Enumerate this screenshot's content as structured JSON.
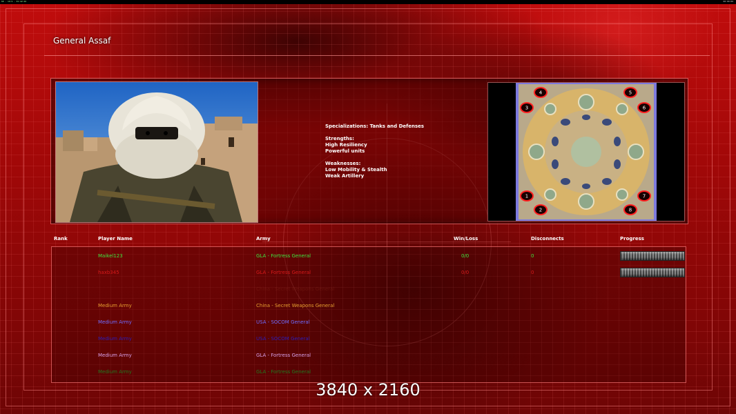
{
  "topbar": {
    "left": "60 · 16:9 · 01:42:46",
    "right": "00:00:00"
  },
  "general": {
    "name": "General Assaf"
  },
  "info": {
    "specializations": "Specializations: Tanks and Defenses",
    "strengths_label": "Strengths:",
    "strengths": [
      "High Resiliency",
      "Powerful units"
    ],
    "weaknesses_label": "Weaknesses:",
    "weaknesses": [
      "Low Mobility & Stealth",
      "Weak Artillery"
    ]
  },
  "map": {
    "start_positions": [
      "1",
      "2",
      "3",
      "4",
      "5",
      "6",
      "7",
      "8"
    ]
  },
  "table": {
    "headers": {
      "rank": "Rank",
      "player": "Player Name",
      "army": "Army",
      "winloss": "Win/Loss",
      "disconnects": "Disconnects",
      "progress": "Progress"
    },
    "rows": [
      {
        "player": "Maikel123",
        "army": "GLA - Fortress General",
        "winloss": "0/0",
        "disconnects": "0",
        "color": "#3fe53f",
        "progress": 0
      },
      {
        "player": "haxb345",
        "army": "GLA - Fortress General",
        "winloss": "0/0",
        "disconnects": "0",
        "color": "#d81a1a",
        "progress": 0
      },
      {
        "player": "",
        "army": "China - Secret Weapons General",
        "winloss": "",
        "disconnects": "",
        "color": "#8a3020"
      },
      {
        "player": "Medium Army",
        "army": "China - Secret Weapons General",
        "winloss": "",
        "disconnects": "",
        "color": "#e8a030"
      },
      {
        "player": "Medium Army",
        "army": "USA - SOCOM General",
        "winloss": "",
        "disconnects": "",
        "color": "#6f6cff"
      },
      {
        "player": "Medium Army",
        "army": "USA - SOCOM General",
        "winloss": "",
        "disconnects": "",
        "color": "#2a1fbf"
      },
      {
        "player": "Medium Army",
        "army": "GLA - Fortress General",
        "winloss": "",
        "disconnects": "",
        "color": "#d8a0e8"
      },
      {
        "player": "Medium Army",
        "army": "GLA - Fortress General",
        "winloss": "",
        "disconnects": "",
        "color": "#1f7a1f"
      }
    ]
  },
  "watermark": "3840 x 2160"
}
